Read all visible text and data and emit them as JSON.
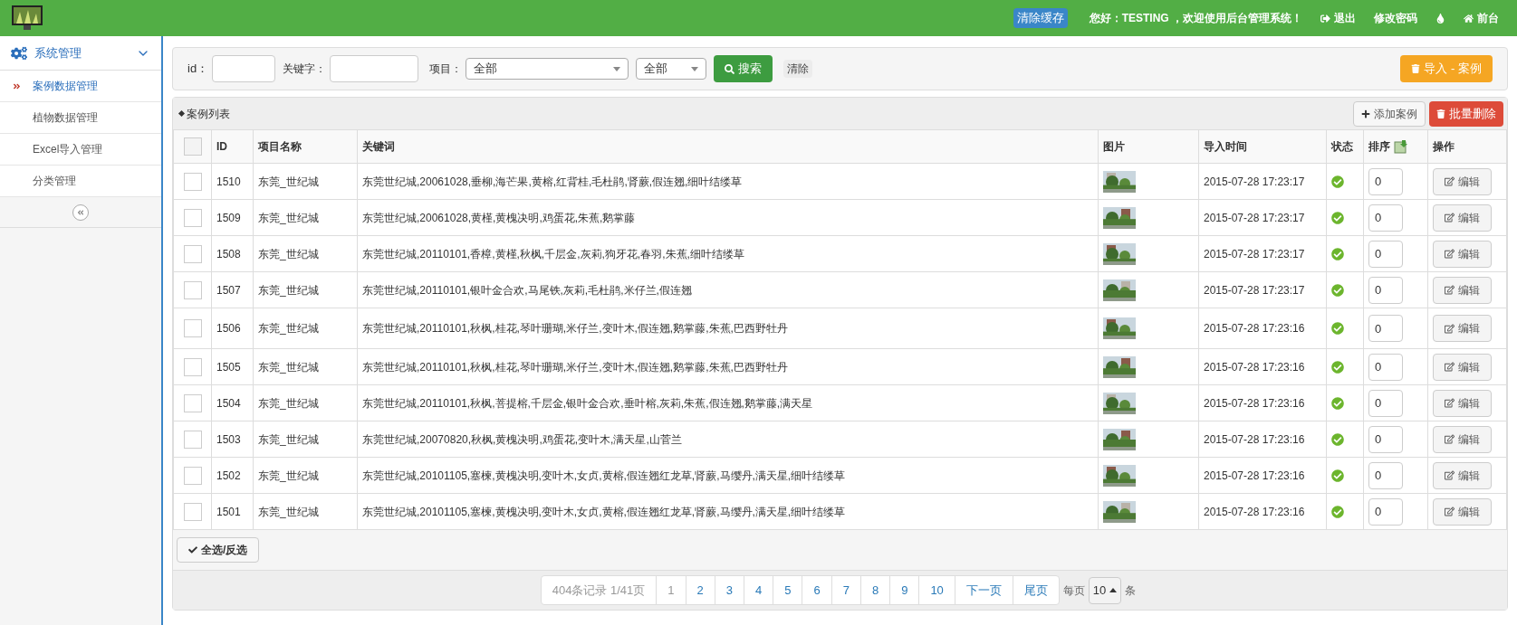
{
  "header": {
    "clear_cache": "清除缓存",
    "greeting": "您好：TESTING ，欢迎使用后台管理系统！",
    "links": [
      {
        "kind": "logout",
        "label": "退出"
      },
      {
        "kind": "password",
        "label": "修改密码"
      },
      {
        "kind": "theme"
      },
      {
        "kind": "home",
        "label": "前台"
      }
    ]
  },
  "sidebar": {
    "group": {
      "label": "系统管理",
      "expanded": true
    },
    "items": [
      {
        "label": "案例数据管理",
        "selected": true
      },
      {
        "label": "植物数据管理",
        "selected": false
      },
      {
        "label": "Excel导入管理",
        "selected": false
      },
      {
        "label": "分类管理",
        "selected": false
      }
    ]
  },
  "filters": {
    "id_label": "id：",
    "keyword_label": "关键字：",
    "project_label": "项目：",
    "project_value": "全部",
    "type_value": "全部",
    "search_button": "搜索",
    "clear_button": "清除",
    "import_button": "导入 - 案例"
  },
  "list": {
    "title": "案例列表",
    "add_button": "添加案例",
    "batch_delete_button": "批量删除",
    "select_all_button": "全选/反选",
    "all_checked": false,
    "columns": [
      "ID",
      "项目名称",
      "关键词",
      "图片",
      "导入时间",
      "状态",
      "排序",
      "操作"
    ],
    "rows": [
      {
        "id": "1510",
        "project": "东莞_世纪城",
        "keywords": "东莞世纪城,20061028,垂柳,海芒果,黄榕,红背桂,毛杜鹃,肾蕨,假连翘,细叶结缕草",
        "time": "2015-07-28 17:23:17",
        "enabled": true,
        "order": "0",
        "edit": "编辑",
        "checked": false
      },
      {
        "id": "1509",
        "project": "东莞_世纪城",
        "keywords": "东莞世纪城,20061028,黄槿,黄槐决明,鸡蛋花,朱蕉,鹅掌藤",
        "time": "2015-07-28 17:23:17",
        "enabled": true,
        "order": "0",
        "edit": "编辑",
        "checked": false
      },
      {
        "id": "1508",
        "project": "东莞_世纪城",
        "keywords": "东莞世纪城,20110101,香樟,黄槿,秋枫,千层金,灰莉,狗牙花,春羽,朱蕉,细叶结缕草",
        "time": "2015-07-28 17:23:17",
        "enabled": true,
        "order": "0",
        "edit": "编辑",
        "checked": false
      },
      {
        "id": "1507",
        "project": "东莞_世纪城",
        "keywords": "东莞世纪城,20110101,银叶金合欢,马尾铁,灰莉,毛杜鹃,米仔兰,假连翘",
        "time": "2015-07-28 17:23:17",
        "enabled": true,
        "order": "0",
        "edit": "编辑",
        "checked": false
      },
      {
        "id": "1506",
        "project": "东莞_世纪城",
        "keywords": "东莞世纪城,20110101,秋枫,桂花,琴叶珊瑚,米仔兰,变叶木,假连翘,鹅掌藤,朱蕉,巴西野牡丹",
        "time": "2015-07-28 17:23:16",
        "enabled": true,
        "order": "0",
        "edit": "编辑",
        "checked": false
      },
      {
        "id": "1505",
        "project": "东莞_世纪城",
        "keywords": "东莞世纪城,20110101,秋枫,桂花,琴叶珊瑚,米仔兰,变叶木,假连翘,鹅掌藤,朱蕉,巴西野牡丹",
        "time": "2015-07-28 17:23:16",
        "enabled": true,
        "order": "0",
        "edit": "编辑",
        "checked": false
      },
      {
        "id": "1504",
        "project": "东莞_世纪城",
        "keywords": "东莞世纪城,20110101,秋枫,菩提榕,千层金,银叶金合欢,垂叶榕,灰莉,朱蕉,假连翘,鹅掌藤,满天星",
        "time": "2015-07-28 17:23:16",
        "enabled": true,
        "order": "0",
        "edit": "编辑",
        "checked": false
      },
      {
        "id": "1503",
        "project": "东莞_世纪城",
        "keywords": "东莞世纪城,20070820,秋枫,黄槐决明,鸡蛋花,变叶木,满天星,山菅兰",
        "time": "2015-07-28 17:23:16",
        "enabled": true,
        "order": "0",
        "edit": "编辑",
        "checked": false
      },
      {
        "id": "1502",
        "project": "东莞_世纪城",
        "keywords": "东莞世纪城,20101105,塞楝,黄槐决明,变叶木,女贞,黄榕,假连翘红龙草,肾蕨,马缨丹,满天星,细叶结缕草",
        "time": "2015-07-28 17:23:16",
        "enabled": true,
        "order": "0",
        "edit": "编辑",
        "checked": false
      },
      {
        "id": "1501",
        "project": "东莞_世纪城",
        "keywords": "东莞世纪城,20101105,塞楝,黄槐决明,变叶木,女贞,黄榕,假连翘红龙草,肾蕨,马缨丹,满天星,细叶结缕草",
        "time": "2015-07-28 17:23:16",
        "enabled": true,
        "order": "0",
        "edit": "编辑",
        "checked": false
      }
    ]
  },
  "pagination": {
    "summary": "404条记录 1/41页",
    "pages": [
      {
        "label": "1",
        "selected": true
      },
      {
        "label": "2",
        "selected": false
      },
      {
        "label": "3",
        "selected": false
      },
      {
        "label": "4",
        "selected": false
      },
      {
        "label": "5",
        "selected": false
      },
      {
        "label": "6",
        "selected": false
      },
      {
        "label": "7",
        "selected": false
      },
      {
        "label": "8",
        "selected": false
      },
      {
        "label": "9",
        "selected": false
      },
      {
        "label": "10",
        "selected": false
      }
    ],
    "next": "下一页",
    "last": "尾页",
    "per_page_label": "每页",
    "per_page_value": "10",
    "per_page_unit": "条"
  }
}
